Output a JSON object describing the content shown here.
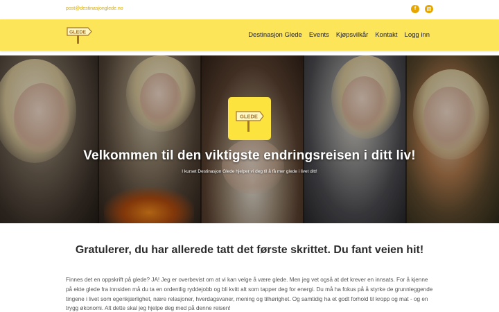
{
  "topbar": {
    "email": "post@destinasjonglede.no",
    "social": [
      {
        "icon": "facebook-icon",
        "glyph": "f"
      },
      {
        "icon": "instagram-icon",
        "glyph": ""
      }
    ]
  },
  "header": {
    "logo_text": "GLEDE",
    "nav": [
      {
        "label": "Destinasjon Glede"
      },
      {
        "label": "Events"
      },
      {
        "label": "Kjøpsvilkår"
      },
      {
        "label": "Kontakt"
      },
      {
        "label": "Logg inn"
      }
    ]
  },
  "hero": {
    "logo_text": "GLEDE",
    "title": "Velkommen til den viktigste endringsreisen i ditt liv!",
    "subtitle": "I kurset Destinasjon Glede hjelper vi deg til å få mer glede i livet ditt!"
  },
  "main": {
    "headline": "Gratulerer, du har allerede tatt det første skrittet. Du fant veien hit!",
    "body": "Finnes det en oppskrift på glede? JA! Jeg er overbevist om at vi kan velge å være glede. Men jeg vet også at det krever en innsats. For å kjenne på ekte glede fra innsiden må du ta en ordentlig ryddejobb og bli kvitt alt som tapper deg for energi. Du må ha fokus på å styrke de grunnleggende tingene i livet som egenkjærlighet, nære relasjoner, hverdagsvaner, mening og tilhørighet. Og samtidig ha et godt forhold til kropp og mat - og en trygg økonomi. Alt dette skal jeg hjelpe deg med på denne reisen!"
  },
  "colors": {
    "header_bg": "#fde55a",
    "accent": "#e6a500",
    "email": "#d4a800"
  }
}
